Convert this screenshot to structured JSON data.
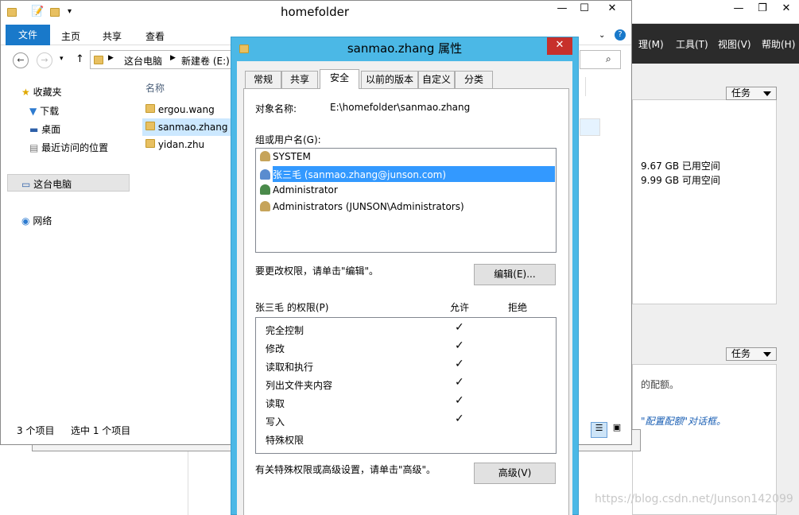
{
  "right_window": {
    "menu": [
      "理(M)",
      "工具(T)",
      "视图(V)",
      "帮助(H)"
    ],
    "task1": "任务",
    "used": "9.67 GB 已用空间",
    "free": "9.99 GB 可用空间",
    "task2": "任务",
    "note1": "的配额。",
    "note2": "\"配置配额\"对话框。"
  },
  "explorer": {
    "title": "homefolder",
    "ribbon_tabs": [
      "文件",
      "主页",
      "共享",
      "查看"
    ],
    "address": [
      "这台电脑",
      "新建卷 (E:)"
    ],
    "sidebar": [
      "收藏夹",
      "下载",
      "桌面",
      "最近访问的位置",
      "这台电脑",
      "网络"
    ],
    "column_header": "名称",
    "files": [
      "ergou.wang",
      "sanmao.zhang",
      "yidan.zhu"
    ],
    "status_count": "3 个项目",
    "status_selected": "选中 1 个项目"
  },
  "dialog": {
    "title": "sanmao.zhang 属性",
    "tabs": [
      "常规",
      "共享",
      "安全",
      "以前的版本",
      "自定义",
      "分类"
    ],
    "object_label": "对象名称:",
    "object_value": "E:\\homefolder\\sanmao.zhang",
    "group_label": "组或用户名(G):",
    "users": [
      "SYSTEM",
      "张三毛 (sanmao.zhang@junson.com)",
      "Administrator",
      "Administrators (JUNSON\\Administrators)"
    ],
    "edit_hint": "要更改权限，请单击\"编辑\"。",
    "edit_button": "编辑(E)...",
    "perm_label": "张三毛 的权限(P)",
    "allow": "允许",
    "deny": "拒绝",
    "permissions": [
      {
        "name": "完全控制",
        "allow": "✓"
      },
      {
        "name": "修改",
        "allow": "✓"
      },
      {
        "name": "读取和执行",
        "allow": "✓"
      },
      {
        "name": "列出文件夹内容",
        "allow": "✓"
      },
      {
        "name": "读取",
        "allow": "✓"
      },
      {
        "name": "写入",
        "allow": "✓"
      },
      {
        "name": "特殊权限",
        "allow": ""
      }
    ],
    "advanced_hint": "有关特殊权限或高级设置，请单击\"高级\"。",
    "advanced_button": "高级(V)"
  },
  "watermark": "https://blog.csdn.net/Junson142099"
}
